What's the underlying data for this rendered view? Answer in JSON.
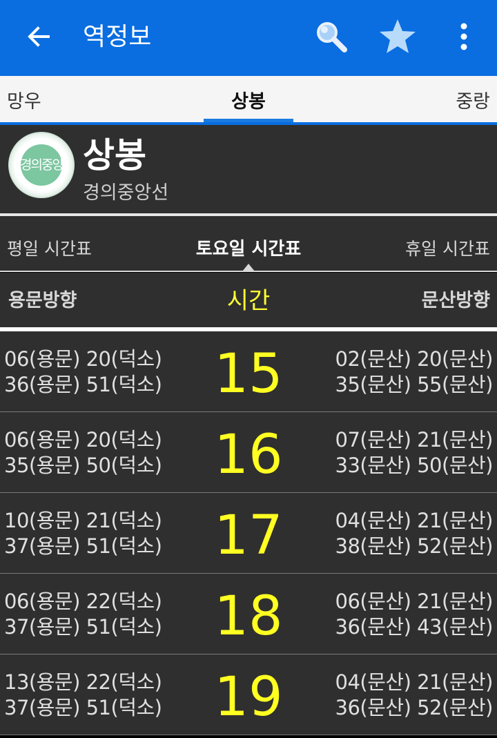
{
  "appbar": {
    "title": "역정보",
    "color": "#0a6de0"
  },
  "station_tabs": {
    "prev": "망우",
    "current": "상봉",
    "next": "중랑"
  },
  "station": {
    "line_badge": "경의중앙",
    "name": "상봉",
    "line": "경의중앙선",
    "line_color": "#7cc6a0"
  },
  "day_tabs": {
    "weekday": "평일 시간표",
    "saturday": "토요일 시간표",
    "holiday": "휴일 시간표",
    "selected": "saturday"
  },
  "columns": {
    "left": "용문방향",
    "center": "시간",
    "right": "문산방향"
  },
  "rows": [
    {
      "hour": "15",
      "left": [
        "06(용문) 20(덕소)",
        "36(용문) 51(덕소)"
      ],
      "right": [
        "02(문산) 20(문산)",
        "35(문산) 55(문산)"
      ]
    },
    {
      "hour": "16",
      "left": [
        "06(용문) 20(덕소)",
        "35(용문) 50(덕소)"
      ],
      "right": [
        "07(문산) 21(문산)",
        "33(문산) 50(문산)"
      ]
    },
    {
      "hour": "17",
      "left": [
        "10(용문) 21(덕소)",
        "37(용문) 51(덕소)"
      ],
      "right": [
        "04(문산) 21(문산)",
        "38(문산) 52(문산)"
      ]
    },
    {
      "hour": "18",
      "left": [
        "06(용문) 22(덕소)",
        "37(용문) 51(덕소)"
      ],
      "right": [
        "06(문산) 21(문산)",
        "36(문산) 43(문산)"
      ]
    },
    {
      "hour": "19",
      "left": [
        "13(용문) 22(덕소)",
        "37(용문) 51(덕소)"
      ],
      "right": [
        "04(문산) 21(문산)",
        "36(문산) 52(문산)"
      ]
    }
  ]
}
